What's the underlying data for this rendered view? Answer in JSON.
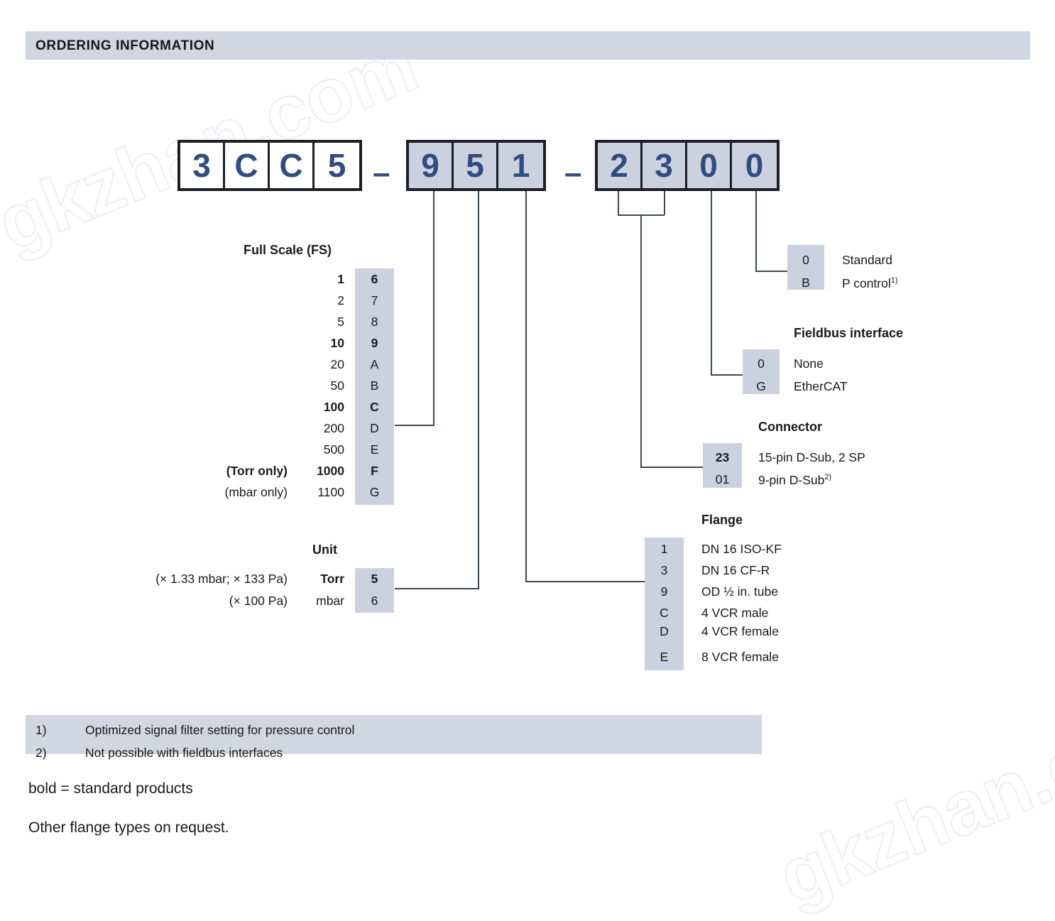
{
  "header": {
    "title": "ORDERING INFORMATION"
  },
  "watermark": {
    "text": "gkzhan.com"
  },
  "part_number": {
    "groups": [
      {
        "chars": [
          "3",
          "C",
          "C",
          "5"
        ],
        "style": "white"
      },
      {
        "chars": [
          "9",
          "5",
          "1"
        ],
        "style": "shaded"
      },
      {
        "chars": [
          "2",
          "3",
          "0",
          "0"
        ],
        "style": "shaded"
      }
    ],
    "separator": "–"
  },
  "sections": {
    "full_scale": {
      "title": "Full Scale (FS)",
      "rows": [
        {
          "prefix": "",
          "value": "1",
          "code": "6",
          "bold": true
        },
        {
          "prefix": "",
          "value": "2",
          "code": "7",
          "bold": false
        },
        {
          "prefix": "",
          "value": "5",
          "code": "8",
          "bold": false
        },
        {
          "prefix": "",
          "value": "10",
          "code": "9",
          "bold": true
        },
        {
          "prefix": "",
          "value": "20",
          "code": "A",
          "bold": false
        },
        {
          "prefix": "",
          "value": "50",
          "code": "B",
          "bold": false
        },
        {
          "prefix": "",
          "value": "100",
          "code": "C",
          "bold": true
        },
        {
          "prefix": "",
          "value": "200",
          "code": "D",
          "bold": false
        },
        {
          "prefix": "",
          "value": "500",
          "code": "E",
          "bold": false
        },
        {
          "prefix": "(Torr only)",
          "value": "1000",
          "code": "F",
          "bold": true
        },
        {
          "prefix": "(mbar only)",
          "value": "1100",
          "code": "G",
          "bold": false
        }
      ]
    },
    "unit": {
      "title": "Unit",
      "rows": [
        {
          "prefix": "(× 1.33 mbar; × 133 Pa)",
          "value": "Torr",
          "code": "5",
          "bold": true
        },
        {
          "prefix": "(× 100 Pa)",
          "value": "mbar",
          "code": "6",
          "bold": false
        }
      ]
    },
    "signal_filter": {
      "title": "",
      "rows": [
        {
          "code": "0",
          "label": "Standard",
          "footnote": "",
          "bold": false
        },
        {
          "code": "B",
          "label": "P control",
          "footnote": "1)",
          "bold": false
        }
      ]
    },
    "fieldbus": {
      "title": "Fieldbus interface",
      "rows": [
        {
          "code": "0",
          "label": "None",
          "footnote": "",
          "bold": false
        },
        {
          "code": "G",
          "label": "EtherCAT",
          "footnote": "",
          "bold": false
        }
      ]
    },
    "connector": {
      "title": "Connector",
      "rows": [
        {
          "code": "23",
          "label": "15-pin D-Sub, 2 SP",
          "footnote": "",
          "bold": true
        },
        {
          "code": "01",
          "label": "9-pin D-Sub",
          "footnote": "2)",
          "bold": false
        }
      ]
    },
    "flange": {
      "title": "Flange",
      "rows": [
        {
          "code": "1",
          "label": "DN 16 ISO-KF",
          "footnote": "",
          "bold": false
        },
        {
          "code": "3",
          "label": "DN 16 CF-R",
          "footnote": "",
          "bold": false
        },
        {
          "code": "9",
          "label": "OD ½ in. tube",
          "footnote": "",
          "bold": false
        },
        {
          "code": "C",
          "label": "4 VCR male",
          "footnote": "",
          "bold": false
        },
        {
          "code": "D",
          "label": "4 VCR female",
          "footnote": "",
          "bold": false
        },
        {
          "code": "E",
          "label": "8 VCR female",
          "footnote": "",
          "bold": false
        }
      ]
    }
  },
  "footnotes": [
    {
      "marker": "1)",
      "text": "Optimized signal filter setting for pressure control"
    },
    {
      "marker": "2)",
      "text": "Not possible with fieldbus interfaces"
    }
  ],
  "notes": [
    {
      "text": "bold = standard products"
    },
    {
      "text": "Other flange types on request."
    }
  ],
  "colors": {
    "shade": "#ccd1e0",
    "band": "#d2d5e2",
    "digit_blue": "#2f4d80",
    "line": "#3c4a53",
    "text": "#1a1a1a"
  }
}
